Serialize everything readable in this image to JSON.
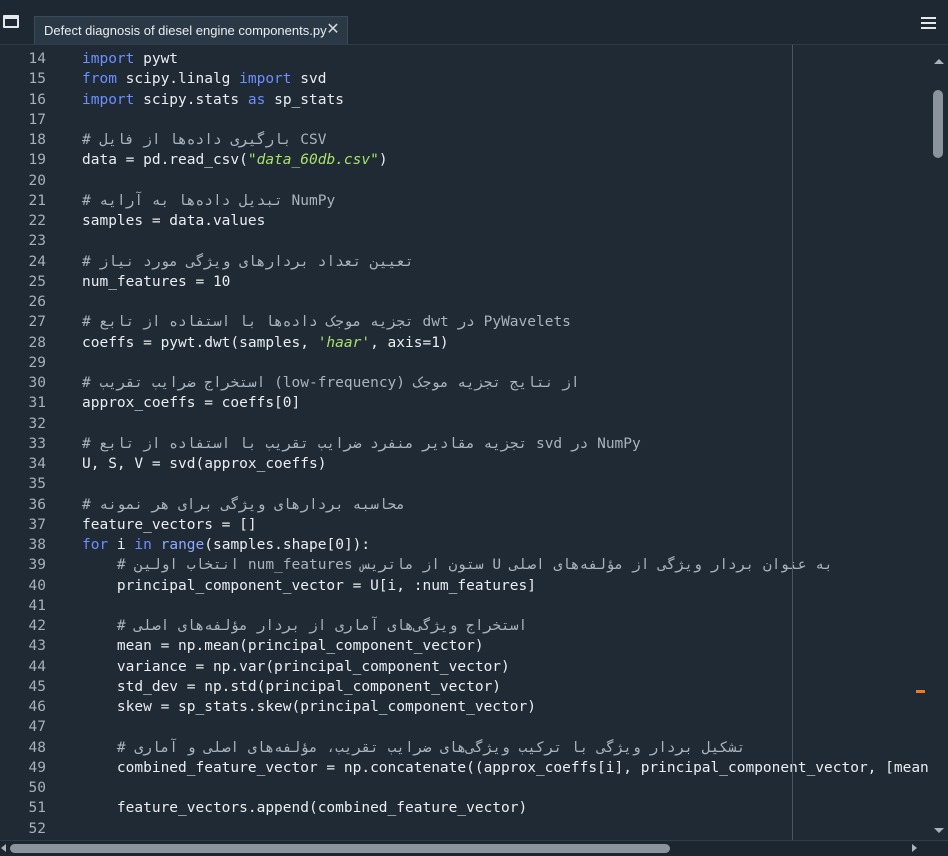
{
  "tab": {
    "title": "Defect diagnosis of diesel engine components.py",
    "close_glyph": "✕"
  },
  "menu_icon": "hamburger-menu-icon",
  "colors": {
    "background": "#1f2a35",
    "keyword": "#6b8fff",
    "string": "#a8e06a",
    "comment": "#aab3bc",
    "text": "#e9edf1",
    "marker": "#f07b1a"
  },
  "lines": [
    {
      "no": "14",
      "segs": [
        {
          "t": "import",
          "c": "kw"
        },
        {
          "t": " pywt"
        }
      ]
    },
    {
      "no": "15",
      "segs": [
        {
          "t": "from",
          "c": "kw"
        },
        {
          "t": " scipy.linalg "
        },
        {
          "t": "import",
          "c": "kw"
        },
        {
          "t": " svd"
        }
      ]
    },
    {
      "no": "16",
      "segs": [
        {
          "t": "import",
          "c": "kw"
        },
        {
          "t": " scipy.stats "
        },
        {
          "t": "as",
          "c": "kw"
        },
        {
          "t": " sp_stats"
        }
      ]
    },
    {
      "no": "17",
      "segs": []
    },
    {
      "no": "18",
      "segs": [
        {
          "t": "# بارگیری داده‌ها از فایل CSV",
          "c": "comment"
        }
      ]
    },
    {
      "no": "19",
      "segs": [
        {
          "t": "data = pd.read_csv("
        },
        {
          "t": "\"data_60db.csv\"",
          "c": "str"
        },
        {
          "t": ")"
        }
      ]
    },
    {
      "no": "20",
      "segs": []
    },
    {
      "no": "21",
      "segs": [
        {
          "t": "# تبدیل داده‌ها به آرایه NumPy",
          "c": "comment"
        }
      ]
    },
    {
      "no": "22",
      "segs": [
        {
          "t": "samples = data.values"
        }
      ]
    },
    {
      "no": "23",
      "segs": []
    },
    {
      "no": "24",
      "segs": [
        {
          "t": "# تعیین تعداد بردارهای ویژگی مورد نیاز",
          "c": "comment"
        }
      ]
    },
    {
      "no": "25",
      "segs": [
        {
          "t": "num_features = 10"
        }
      ]
    },
    {
      "no": "26",
      "segs": []
    },
    {
      "no": "27",
      "segs": [
        {
          "t": "# تجزیه موجک داده‌ها با استفاده از تابع dwt در PyWavelets",
          "c": "comment"
        }
      ]
    },
    {
      "no": "28",
      "segs": [
        {
          "t": "coeffs = pywt.dwt(samples, "
        },
        {
          "t": "'haar'",
          "c": "str"
        },
        {
          "t": ", axis=1)"
        }
      ]
    },
    {
      "no": "29",
      "segs": []
    },
    {
      "no": "30",
      "segs": [
        {
          "t": "# استخراج ضرایب تقریب (low-frequency) از نتایج تجزیه موجک",
          "c": "comment"
        }
      ]
    },
    {
      "no": "31",
      "segs": [
        {
          "t": "approx_coeffs = coeffs[0]"
        }
      ]
    },
    {
      "no": "32",
      "segs": []
    },
    {
      "no": "33",
      "segs": [
        {
          "t": "# تجزیه مقادیر منفرد ضرایب تقریب با استفاده از تابع svd در NumPy",
          "c": "comment"
        }
      ]
    },
    {
      "no": "34",
      "segs": [
        {
          "t": "U, S, V = svd(approx_coeffs)"
        }
      ]
    },
    {
      "no": "35",
      "segs": []
    },
    {
      "no": "36",
      "segs": [
        {
          "t": "# محاسبه بردارهای ویژگی برای هر نمونه",
          "c": "comment"
        }
      ]
    },
    {
      "no": "37",
      "segs": [
        {
          "t": "feature_vectors = []"
        }
      ]
    },
    {
      "no": "38",
      "segs": [
        {
          "t": "for",
          "c": "kw"
        },
        {
          "t": " i "
        },
        {
          "t": "in",
          "c": "kw"
        },
        {
          "t": " "
        },
        {
          "t": "range",
          "c": "kw2"
        },
        {
          "t": "(samples.shape[0]):"
        }
      ]
    },
    {
      "no": "39",
      "segs": [
        {
          "t": "    # انتخاب اولین num_features ستون از ماتریس U به عنوان بردار ویژگی از مؤلفه‌های اصلی",
          "c": "comment"
        }
      ]
    },
    {
      "no": "40",
      "segs": [
        {
          "t": "    principal_component_vector = U[i, :num_features]"
        }
      ]
    },
    {
      "no": "41",
      "segs": []
    },
    {
      "no": "42",
      "segs": [
        {
          "t": "    # استخراج ویژگی‌های آماری از بردار مؤلفه‌های اصلی",
          "c": "comment"
        }
      ]
    },
    {
      "no": "43",
      "segs": [
        {
          "t": "    mean = np.mean(principal_component_vector)"
        }
      ]
    },
    {
      "no": "44",
      "segs": [
        {
          "t": "    variance = np.var(principal_component_vector)"
        }
      ]
    },
    {
      "no": "45",
      "segs": [
        {
          "t": "    std_dev = np.std(principal_component_vector)"
        }
      ]
    },
    {
      "no": "46",
      "segs": [
        {
          "t": "    skew = sp_stats.skew(principal_component_vector)"
        }
      ]
    },
    {
      "no": "47",
      "segs": []
    },
    {
      "no": "48",
      "segs": [
        {
          "t": "    # تشکیل بردار ویژگی با ترکیب ویژگی‌های ضرایب تقریب، مؤلفه‌های اصلی و آماری",
          "c": "comment"
        }
      ]
    },
    {
      "no": "49",
      "segs": [
        {
          "t": "    combined_feature_vector = np.concatenate((approx_coeffs[i], principal_component_vector, [mean, variance, std_dev, skew]))"
        }
      ]
    },
    {
      "no": "50",
      "segs": []
    },
    {
      "no": "51",
      "segs": [
        {
          "t": "    feature_vectors.append(combined_feature_vector)"
        }
      ]
    },
    {
      "no": "52",
      "segs": []
    }
  ]
}
